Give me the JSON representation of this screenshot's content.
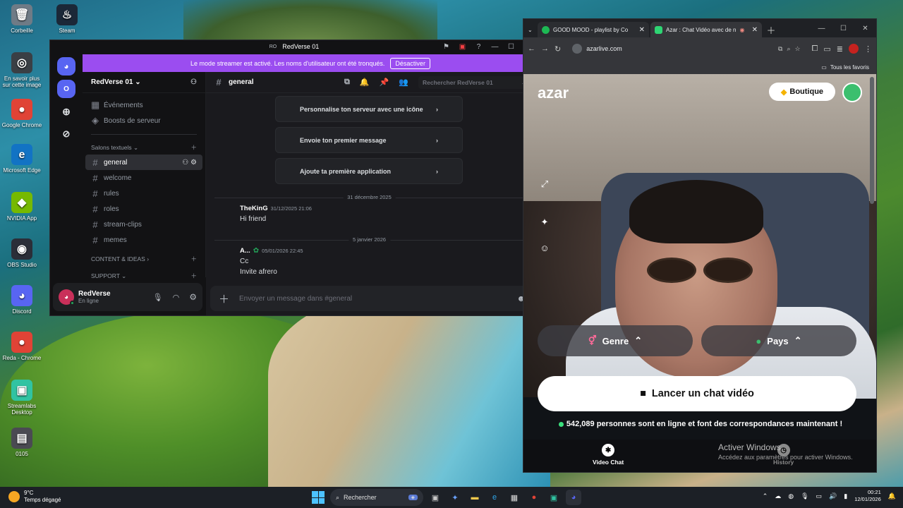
{
  "desktop": {
    "icons": [
      {
        "label": "Corbeille",
        "glyph": "🗑",
        "color": "#6f7b86"
      },
      {
        "label": "Steam",
        "glyph": "♨",
        "color": "#1b2838"
      },
      {
        "label": "En savoir plus sur cette image",
        "glyph": "◎",
        "color": "#3a3f45"
      },
      {
        "label": "Google Chrome",
        "glyph": "●",
        "color": "#e04336"
      },
      {
        "label": "Microsoft Edge",
        "glyph": "e",
        "color": "#1273c4"
      },
      {
        "label": "NVIDIA App",
        "glyph": "◆",
        "color": "#76b900"
      },
      {
        "label": "OBS Studio",
        "glyph": "◉",
        "color": "#2b2e38"
      },
      {
        "label": "Discord",
        "glyph": "◕",
        "color": "#5865f2"
      },
      {
        "label": "Reda - Chrome",
        "glyph": "●",
        "color": "#e04336"
      },
      {
        "label": "Streamlabs Desktop",
        "glyph": "▣",
        "color": "#31c3a2"
      },
      {
        "label": "0105",
        "glyph": "▤",
        "color": "#4a4a52"
      }
    ]
  },
  "discord": {
    "window_title": "RedVerse 01",
    "title_badge": "RO",
    "rail_badge": "O",
    "banner": {
      "text": "Le mode streamer est activé. Les noms d'utilisateur ont été tronqués.",
      "button": "Désactiver"
    },
    "server_name": "RedVerse 01",
    "menu": [
      "Événements",
      "Boosts de serveur"
    ],
    "categories": {
      "text": "Salons textuels",
      "content": "CONTENT & IDEAS",
      "support": "SUPPORT"
    },
    "channels": [
      "general",
      "welcome",
      "rules",
      "roles",
      "stream-clips",
      "memes"
    ],
    "active_channel": "general",
    "search_placeholder": "Rechercher RedVerse 01",
    "cards": [
      "Personnalise ton serveur avec une icône",
      "Envoie ton premier message",
      "Ajoute ta première application"
    ],
    "dividers": [
      "31 décembre 2025",
      "5 janvier 2026"
    ],
    "messages": [
      {
        "author": "TheKinG",
        "time": "31/12/2025 21:06",
        "lines": [
          "Hi friend"
        ]
      },
      {
        "author": "A...",
        "time": "05/01/2026 22:45",
        "lines": [
          "Cc",
          "Invite afrero"
        ]
      }
    ],
    "composer_placeholder": "Envoyer un message dans #general",
    "user": {
      "name": "RedVerse",
      "status": "En ligne"
    }
  },
  "chrome": {
    "tabs": [
      {
        "title": "GOOD MOOD - playlist by Co",
        "color": "#1db954"
      },
      {
        "title": "Azar : Chat Vidéo avec de n",
        "color": "#2ed573"
      }
    ],
    "url": "azarlive.com",
    "bookmarks": "Tous les favoris",
    "azar": {
      "logo": "azar",
      "boutique": "Boutique",
      "genre": "Genre",
      "pays": "Pays",
      "launch": "Lancer un chat vidéo",
      "online": "542,089 personnes sont en ligne et font des correspondances maintenant !",
      "nav_video": "Video Chat",
      "nav_history": "History"
    },
    "watermark": {
      "title": "Activer Windows",
      "sub": "Accédez aux paramètres pour activer Windows."
    }
  },
  "taskbar": {
    "weather_temp": "9°C",
    "weather_desc": "Temps dégagé",
    "search": "Rechercher",
    "time": "00:21",
    "date": "12/01/2026"
  }
}
